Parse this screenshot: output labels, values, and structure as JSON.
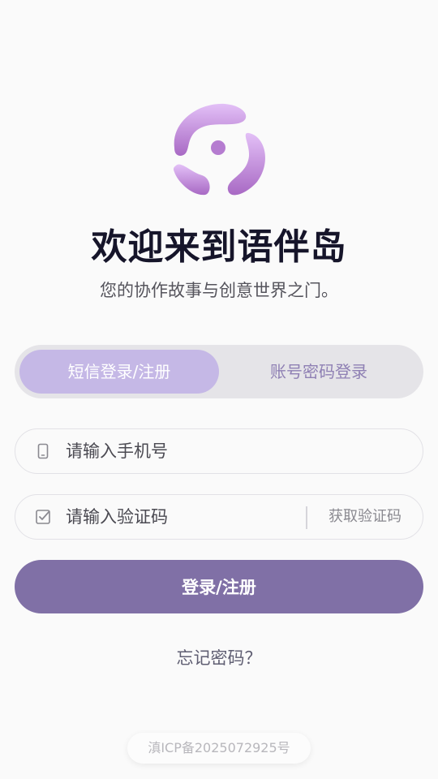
{
  "app": {
    "title": "欢迎来到语伴岛",
    "subtitle": "您的协作故事与创意世界之门。",
    "logo_icon": "app-logo-icon",
    "colors": {
      "accent": "#8070a6",
      "tab_active": "#c5b8e6",
      "tab_inactive_text": "#8f80b4"
    }
  },
  "tabs": {
    "sms_login": "短信登录/注册",
    "password_login": "账号密码登录",
    "active": "sms_login"
  },
  "form": {
    "phone": {
      "placeholder": "请输入手机号",
      "value": "",
      "icon": "phone-icon"
    },
    "code": {
      "placeholder": "请输入验证码",
      "value": "",
      "icon": "checkbox-icon",
      "get_code_label": "获取验证码"
    },
    "submit_label": "登录/注册",
    "forgot_label": "忘记密码？"
  },
  "footer": {
    "icp": "滇ICP备2025072925号"
  }
}
